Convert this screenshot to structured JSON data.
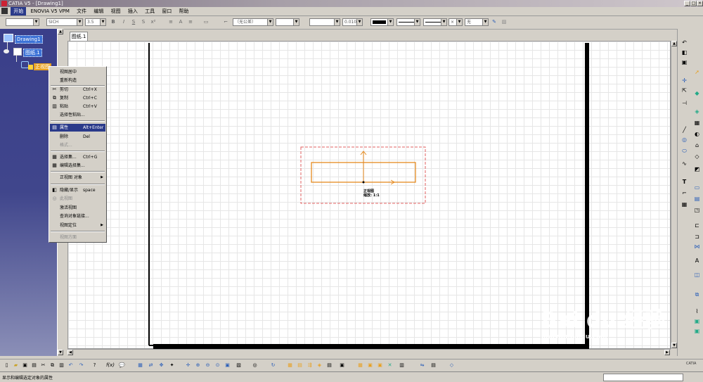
{
  "window": {
    "title": "CATIA V5 - [Drawing1]"
  },
  "menu": {
    "items": [
      "开始",
      "ENOVIA V5 VPM",
      "文件",
      "编辑",
      "视图",
      "插入",
      "工具",
      "窗口",
      "帮助"
    ]
  },
  "toolbar_top": {
    "font_name": "SICH",
    "font_size": "3.5",
    "tolerance": "（无公差）",
    "precision": "0.010",
    "fill": "无"
  },
  "tree": {
    "root": "Drawing1",
    "sheet": "图纸.1",
    "view": "正视图"
  },
  "tabs": [
    {
      "label": "图纸.1"
    }
  ],
  "context_menu": {
    "items": [
      {
        "label": "视图居中",
        "shortcut": "",
        "icon": "",
        "disabled": false
      },
      {
        "label": "重新构造",
        "shortcut": "",
        "icon": "",
        "disabled": false
      },
      {
        "label": "剪切",
        "shortcut": "Ctrl+X",
        "icon": "cut-icon",
        "disabled": false
      },
      {
        "label": "复制",
        "shortcut": "Ctrl+C",
        "icon": "copy-icon",
        "disabled": false
      },
      {
        "label": "粘贴",
        "shortcut": "Ctrl+V",
        "icon": "paste-icon",
        "disabled": false
      },
      {
        "label": "选择性粘贴...",
        "shortcut": "",
        "icon": "",
        "disabled": false
      },
      {
        "label": "属性",
        "shortcut": "Alt+Enter",
        "icon": "properties-icon",
        "disabled": false,
        "highlighted": true
      },
      {
        "label": "删除",
        "shortcut": "Del",
        "icon": "",
        "disabled": false
      },
      {
        "label": "格式...",
        "shortcut": "",
        "icon": "",
        "disabled": true
      },
      {
        "label": "选择集...",
        "shortcut": "Ctrl+G",
        "icon": "selection-set-icon",
        "disabled": false
      },
      {
        "label": "编辑选择集...",
        "shortcut": "",
        "icon": "edit-selection-set-icon",
        "disabled": false
      },
      {
        "label": "正视图 对象",
        "shortcut": "",
        "icon": "",
        "disabled": false,
        "submenu": true
      },
      {
        "label": "隐藏/显示",
        "shortcut": "space",
        "icon": "hide-show-icon",
        "disabled": false
      },
      {
        "label": "此视图",
        "shortcut": "",
        "icon": "view-icon",
        "disabled": true
      },
      {
        "label": "激活视图",
        "shortcut": "",
        "icon": "",
        "disabled": false
      },
      {
        "label": "查询对象链接...",
        "shortcut": "",
        "icon": "",
        "disabled": false
      },
      {
        "label": "视图定位",
        "shortcut": "",
        "icon": "",
        "disabled": false,
        "submenu": true
      },
      {
        "label": "视图方面",
        "shortcut": "",
        "icon": "",
        "disabled": true
      }
    ]
  },
  "drawing": {
    "view_label": "正视图",
    "view_scale": "缩放: 1:1"
  },
  "status": {
    "text": "显示和编辑选定对象的属性"
  },
  "watermark": {
    "line1": "Bai du 经验",
    "line2": "jingyan.baidu.com"
  },
  "colors": {
    "accent": "#2a3a8a",
    "view_frame": "#e06060",
    "geometry": "#e58a1f"
  }
}
